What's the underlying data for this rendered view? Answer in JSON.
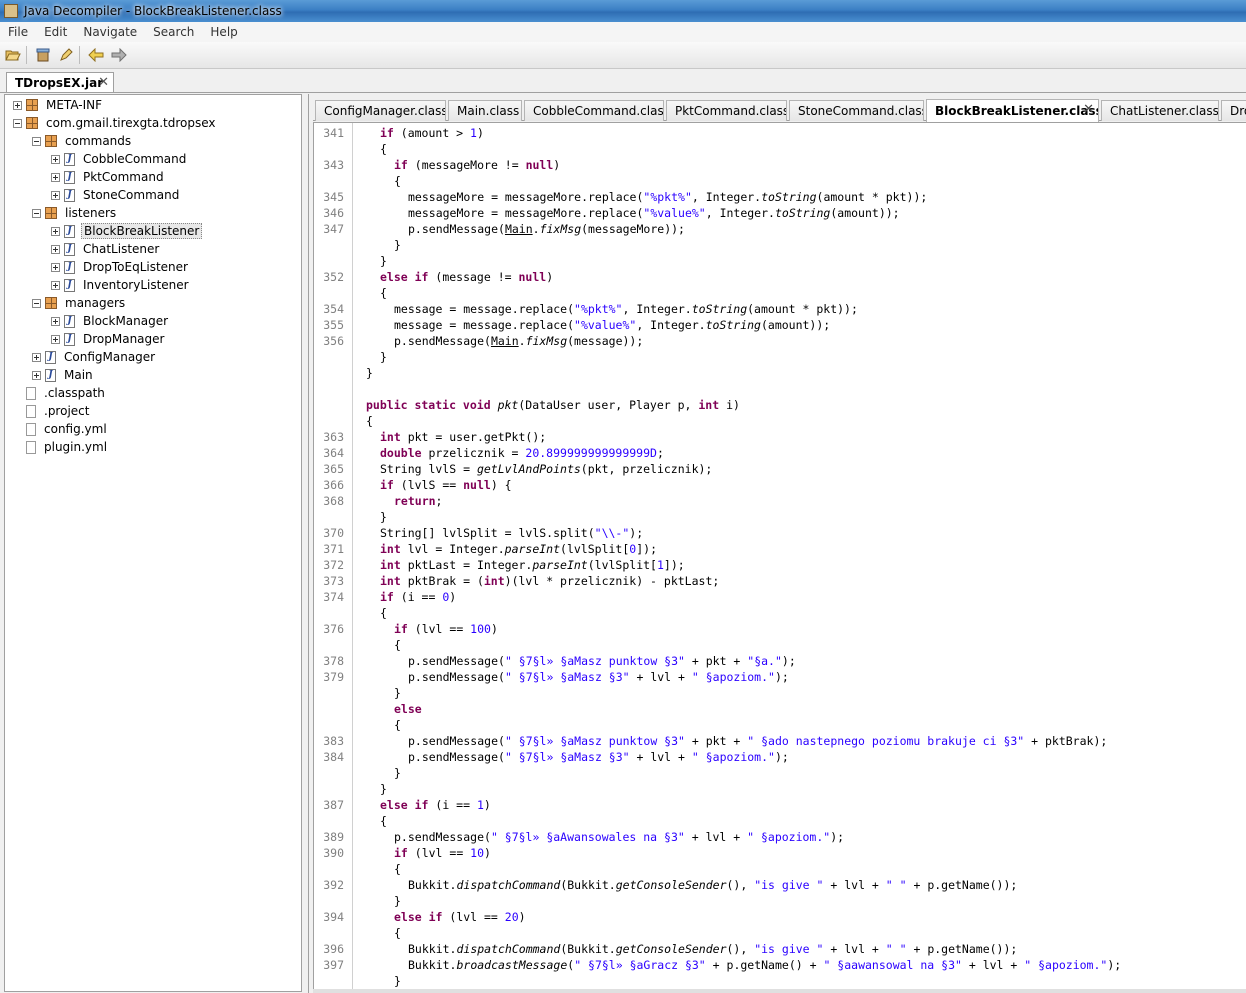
{
  "window": {
    "title": "Java Decompiler - BlockBreakListener.class"
  },
  "menu": [
    "File",
    "Edit",
    "Navigate",
    "Search",
    "Help"
  ],
  "toolbar": {
    "icons": [
      "open-file-icon",
      "open-jar-icon",
      "edit-icon",
      "back-arrow-icon",
      "forward-arrow-icon"
    ]
  },
  "jar_tab": {
    "label": "TDropsEX.jar",
    "close": "✕"
  },
  "tree": [
    {
      "label": "META-INF",
      "type": "package",
      "depth": 0,
      "expander": "closed"
    },
    {
      "label": "com.gmail.tirexgta.tdropsex",
      "type": "package",
      "depth": 0,
      "expander": "open"
    },
    {
      "label": "commands",
      "type": "package",
      "depth": 1,
      "expander": "open"
    },
    {
      "label": "CobbleCommand",
      "type": "class",
      "depth": 2,
      "expander": "closed"
    },
    {
      "label": "PktCommand",
      "type": "class",
      "depth": 2,
      "expander": "closed"
    },
    {
      "label": "StoneCommand",
      "type": "class",
      "depth": 2,
      "expander": "closed"
    },
    {
      "label": "listeners",
      "type": "package",
      "depth": 1,
      "expander": "open"
    },
    {
      "label": "BlockBreakListener",
      "type": "class",
      "depth": 2,
      "expander": "closed",
      "selected": true
    },
    {
      "label": "ChatListener",
      "type": "class",
      "depth": 2,
      "expander": "closed"
    },
    {
      "label": "DropToEqListener",
      "type": "class",
      "depth": 2,
      "expander": "closed"
    },
    {
      "label": "InventoryListener",
      "type": "class",
      "depth": 2,
      "expander": "closed"
    },
    {
      "label": "managers",
      "type": "package",
      "depth": 1,
      "expander": "open"
    },
    {
      "label": "BlockManager",
      "type": "class",
      "depth": 2,
      "expander": "closed"
    },
    {
      "label": "DropManager",
      "type": "class",
      "depth": 2,
      "expander": "closed"
    },
    {
      "label": "ConfigManager",
      "type": "class",
      "depth": 1,
      "expander": "closed"
    },
    {
      "label": "Main",
      "type": "class",
      "depth": 1,
      "expander": "closed"
    },
    {
      "label": ".classpath",
      "type": "file",
      "depth": 0
    },
    {
      "label": ".project",
      "type": "file",
      "depth": 0
    },
    {
      "label": "config.yml",
      "type": "file",
      "depth": 0
    },
    {
      "label": "plugin.yml",
      "type": "file",
      "depth": 0
    }
  ],
  "class_tabs": [
    {
      "label": "ConfigManager.class"
    },
    {
      "label": "Main.class"
    },
    {
      "label": "CobbleCommand.class"
    },
    {
      "label": "PktCommand.class"
    },
    {
      "label": "StoneCommand.class"
    },
    {
      "label": "BlockBreakListener.class",
      "active": true,
      "close": "✕"
    },
    {
      "label": "ChatListener.class"
    },
    {
      "label": "Drop"
    }
  ],
  "code_lines": [
    {
      "n": "341",
      "indent": 1,
      "parts": [
        [
          "kw",
          "if"
        ],
        [
          "t",
          " (amount > "
        ],
        [
          "num",
          "1"
        ],
        [
          "t",
          ")"
        ]
      ]
    },
    {
      "n": "",
      "indent": 1,
      "parts": [
        [
          "t",
          "{"
        ]
      ]
    },
    {
      "n": "343",
      "indent": 2,
      "parts": [
        [
          "kw",
          "if"
        ],
        [
          "t",
          " (messageMore != "
        ],
        [
          "kw",
          "null"
        ],
        [
          "t",
          ")"
        ]
      ]
    },
    {
      "n": "",
      "indent": 2,
      "parts": [
        [
          "t",
          "{"
        ]
      ]
    },
    {
      "n": "345",
      "indent": 3,
      "parts": [
        [
          "t",
          "messageMore = messageMore.replace("
        ],
        [
          "str",
          "\"%pkt%\""
        ],
        [
          "t",
          ", Integer."
        ],
        [
          "it",
          "toString"
        ],
        [
          "t",
          "(amount * pkt));"
        ]
      ]
    },
    {
      "n": "346",
      "indent": 3,
      "parts": [
        [
          "t",
          "messageMore = messageMore.replace("
        ],
        [
          "str",
          "\"%value%\""
        ],
        [
          "t",
          ", Integer."
        ],
        [
          "it",
          "toString"
        ],
        [
          "t",
          "(amount));"
        ]
      ]
    },
    {
      "n": "347",
      "indent": 3,
      "parts": [
        [
          "t",
          "p.sendMessage("
        ],
        [
          "ul",
          "Main"
        ],
        [
          "t",
          "."
        ],
        [
          "it",
          "fixMsg"
        ],
        [
          "t",
          "(messageMore));"
        ]
      ]
    },
    {
      "n": "",
      "indent": 2,
      "parts": [
        [
          "t",
          "}"
        ]
      ]
    },
    {
      "n": "",
      "indent": 1,
      "parts": [
        [
          "t",
          "}"
        ]
      ]
    },
    {
      "n": "352",
      "indent": 1,
      "parts": [
        [
          "kw",
          "else if"
        ],
        [
          "t",
          " (message != "
        ],
        [
          "kw",
          "null"
        ],
        [
          "t",
          ")"
        ]
      ]
    },
    {
      "n": "",
      "indent": 1,
      "parts": [
        [
          "t",
          "{"
        ]
      ]
    },
    {
      "n": "354",
      "indent": 2,
      "parts": [
        [
          "t",
          "message = message.replace("
        ],
        [
          "str",
          "\"%pkt%\""
        ],
        [
          "t",
          ", Integer."
        ],
        [
          "it",
          "toString"
        ],
        [
          "t",
          "(amount * pkt));"
        ]
      ]
    },
    {
      "n": "355",
      "indent": 2,
      "parts": [
        [
          "t",
          "message = message.replace("
        ],
        [
          "str",
          "\"%value%\""
        ],
        [
          "t",
          ", Integer."
        ],
        [
          "it",
          "toString"
        ],
        [
          "t",
          "(amount));"
        ]
      ]
    },
    {
      "n": "356",
      "indent": 2,
      "parts": [
        [
          "t",
          "p.sendMessage("
        ],
        [
          "ul",
          "Main"
        ],
        [
          "t",
          "."
        ],
        [
          "it",
          "fixMsg"
        ],
        [
          "t",
          "(message));"
        ]
      ]
    },
    {
      "n": "",
      "indent": 1,
      "parts": [
        [
          "t",
          "}"
        ]
      ]
    },
    {
      "n": "",
      "indent": 0,
      "parts": [
        [
          "t",
          "}"
        ]
      ]
    },
    {
      "n": "",
      "indent": 0,
      "parts": []
    },
    {
      "n": "",
      "indent": 0,
      "parts": [
        [
          "kw",
          "public static void"
        ],
        [
          "t",
          " "
        ],
        [
          "it",
          "pkt"
        ],
        [
          "t",
          "(DataUser user, Player p, "
        ],
        [
          "kw",
          "int"
        ],
        [
          "t",
          " i)"
        ]
      ]
    },
    {
      "n": "",
      "indent": 0,
      "parts": [
        [
          "t",
          "{"
        ]
      ]
    },
    {
      "n": "363",
      "indent": 1,
      "parts": [
        [
          "kw",
          "int"
        ],
        [
          "t",
          " pkt = user.getPkt();"
        ]
      ]
    },
    {
      "n": "364",
      "indent": 1,
      "parts": [
        [
          "kw",
          "double"
        ],
        [
          "t",
          " przelicznik = "
        ],
        [
          "num",
          "20.899999999999999D"
        ],
        [
          "t",
          ";"
        ]
      ]
    },
    {
      "n": "365",
      "indent": 1,
      "parts": [
        [
          "t",
          "String lvlS = "
        ],
        [
          "it",
          "getLvlAndPoints"
        ],
        [
          "t",
          "(pkt, przelicznik);"
        ]
      ]
    },
    {
      "n": "366",
      "indent": 1,
      "parts": [
        [
          "kw",
          "if"
        ],
        [
          "t",
          " (lvlS == "
        ],
        [
          "kw",
          "null"
        ],
        [
          "t",
          ") {"
        ]
      ]
    },
    {
      "n": "368",
      "indent": 2,
      "parts": [
        [
          "kw",
          "return"
        ],
        [
          "t",
          ";"
        ]
      ]
    },
    {
      "n": "",
      "indent": 1,
      "parts": [
        [
          "t",
          "}"
        ]
      ]
    },
    {
      "n": "370",
      "indent": 1,
      "parts": [
        [
          "t",
          "String[] lvlSplit = lvlS.split("
        ],
        [
          "str",
          "\"\\\\-\""
        ],
        [
          "t",
          ");"
        ]
      ]
    },
    {
      "n": "371",
      "indent": 1,
      "parts": [
        [
          "kw",
          "int"
        ],
        [
          "t",
          " lvl = Integer."
        ],
        [
          "it",
          "parseInt"
        ],
        [
          "t",
          "(lvlSplit["
        ],
        [
          "num",
          "0"
        ],
        [
          "t",
          "]);"
        ]
      ]
    },
    {
      "n": "372",
      "indent": 1,
      "parts": [
        [
          "kw",
          "int"
        ],
        [
          "t",
          " pktLast = Integer."
        ],
        [
          "it",
          "parseInt"
        ],
        [
          "t",
          "(lvlSplit["
        ],
        [
          "num",
          "1"
        ],
        [
          "t",
          "]);"
        ]
      ]
    },
    {
      "n": "373",
      "indent": 1,
      "parts": [
        [
          "kw",
          "int"
        ],
        [
          "t",
          " pktBrak = ("
        ],
        [
          "kw",
          "int"
        ],
        [
          "t",
          ")(lvl * przelicznik) - pktLast;"
        ]
      ]
    },
    {
      "n": "374",
      "indent": 1,
      "parts": [
        [
          "kw",
          "if"
        ],
        [
          "t",
          " (i == "
        ],
        [
          "num",
          "0"
        ],
        [
          "t",
          ")"
        ]
      ]
    },
    {
      "n": "",
      "indent": 1,
      "parts": [
        [
          "t",
          "{"
        ]
      ]
    },
    {
      "n": "376",
      "indent": 2,
      "parts": [
        [
          "kw",
          "if"
        ],
        [
          "t",
          " (lvl == "
        ],
        [
          "num",
          "100"
        ],
        [
          "t",
          ")"
        ]
      ]
    },
    {
      "n": "",
      "indent": 2,
      "parts": [
        [
          "t",
          "{"
        ]
      ]
    },
    {
      "n": "378",
      "indent": 3,
      "parts": [
        [
          "t",
          "p.sendMessage("
        ],
        [
          "str",
          "\" §7§l» §aMasz punktow §3\""
        ],
        [
          "t",
          " + pkt + "
        ],
        [
          "str",
          "\"§a.\""
        ],
        [
          "t",
          ");"
        ]
      ]
    },
    {
      "n": "379",
      "indent": 3,
      "parts": [
        [
          "t",
          "p.sendMessage("
        ],
        [
          "str",
          "\" §7§l» §aMasz §3\""
        ],
        [
          "t",
          " + lvl + "
        ],
        [
          "str",
          "\" §apoziom.\""
        ],
        [
          "t",
          ");"
        ]
      ]
    },
    {
      "n": "",
      "indent": 2,
      "parts": [
        [
          "t",
          "}"
        ]
      ]
    },
    {
      "n": "",
      "indent": 2,
      "parts": [
        [
          "kw",
          "else"
        ]
      ]
    },
    {
      "n": "",
      "indent": 2,
      "parts": [
        [
          "t",
          "{"
        ]
      ]
    },
    {
      "n": "383",
      "indent": 3,
      "parts": [
        [
          "t",
          "p.sendMessage("
        ],
        [
          "str",
          "\" §7§l» §aMasz punktow §3\""
        ],
        [
          "t",
          " + pkt + "
        ],
        [
          "str",
          "\" §ado nastepnego poziomu brakuje ci §3\""
        ],
        [
          "t",
          " + pktBrak);"
        ]
      ]
    },
    {
      "n": "384",
      "indent": 3,
      "parts": [
        [
          "t",
          "p.sendMessage("
        ],
        [
          "str",
          "\" §7§l» §aMasz §3\""
        ],
        [
          "t",
          " + lvl + "
        ],
        [
          "str",
          "\" §apoziom.\""
        ],
        [
          "t",
          ");"
        ]
      ]
    },
    {
      "n": "",
      "indent": 2,
      "parts": [
        [
          "t",
          "}"
        ]
      ]
    },
    {
      "n": "",
      "indent": 1,
      "parts": [
        [
          "t",
          "}"
        ]
      ]
    },
    {
      "n": "387",
      "indent": 1,
      "parts": [
        [
          "kw",
          "else if"
        ],
        [
          "t",
          " (i == "
        ],
        [
          "num",
          "1"
        ],
        [
          "t",
          ")"
        ]
      ]
    },
    {
      "n": "",
      "indent": 1,
      "parts": [
        [
          "t",
          "{"
        ]
      ]
    },
    {
      "n": "389",
      "indent": 2,
      "parts": [
        [
          "t",
          "p.sendMessage("
        ],
        [
          "str",
          "\" §7§l» §aAwansowales na §3\""
        ],
        [
          "t",
          " + lvl + "
        ],
        [
          "str",
          "\" §apoziom.\""
        ],
        [
          "t",
          ");"
        ]
      ]
    },
    {
      "n": "390",
      "indent": 2,
      "parts": [
        [
          "kw",
          "if"
        ],
        [
          "t",
          " (lvl == "
        ],
        [
          "num",
          "10"
        ],
        [
          "t",
          ")"
        ]
      ]
    },
    {
      "n": "",
      "indent": 2,
      "parts": [
        [
          "t",
          "{"
        ]
      ]
    },
    {
      "n": "392",
      "indent": 3,
      "parts": [
        [
          "t",
          "Bukkit."
        ],
        [
          "it",
          "dispatchCommand"
        ],
        [
          "t",
          "(Bukkit."
        ],
        [
          "it",
          "getConsoleSender"
        ],
        [
          "t",
          "(), "
        ],
        [
          "str",
          "\"is give \""
        ],
        [
          "t",
          " + lvl + "
        ],
        [
          "str",
          "\" \""
        ],
        [
          "t",
          " + p.getName());"
        ]
      ]
    },
    {
      "n": "",
      "indent": 2,
      "parts": [
        [
          "t",
          "}"
        ]
      ]
    },
    {
      "n": "394",
      "indent": 2,
      "parts": [
        [
          "kw",
          "else if"
        ],
        [
          "t",
          " (lvl == "
        ],
        [
          "num",
          "20"
        ],
        [
          "t",
          ")"
        ]
      ]
    },
    {
      "n": "",
      "indent": 2,
      "parts": [
        [
          "t",
          "{"
        ]
      ]
    },
    {
      "n": "396",
      "indent": 3,
      "parts": [
        [
          "t",
          "Bukkit."
        ],
        [
          "it",
          "dispatchCommand"
        ],
        [
          "t",
          "(Bukkit."
        ],
        [
          "it",
          "getConsoleSender"
        ],
        [
          "t",
          "(), "
        ],
        [
          "str",
          "\"is give \""
        ],
        [
          "t",
          " + lvl + "
        ],
        [
          "str",
          "\" \""
        ],
        [
          "t",
          " + p.getName());"
        ]
      ]
    },
    {
      "n": "397",
      "indent": 3,
      "parts": [
        [
          "t",
          "Bukkit."
        ],
        [
          "it",
          "broadcastMessage"
        ],
        [
          "t",
          "("
        ],
        [
          "str",
          "\" §7§l» §aGracz §3\""
        ],
        [
          "t",
          " + p.getName() + "
        ],
        [
          "str",
          "\" §aawansowal na §3\""
        ],
        [
          "t",
          " + lvl + "
        ],
        [
          "str",
          "\" §apoziom.\""
        ],
        [
          "t",
          ");"
        ]
      ]
    },
    {
      "n": "",
      "indent": 2,
      "parts": [
        [
          "t",
          "}"
        ]
      ]
    }
  ]
}
